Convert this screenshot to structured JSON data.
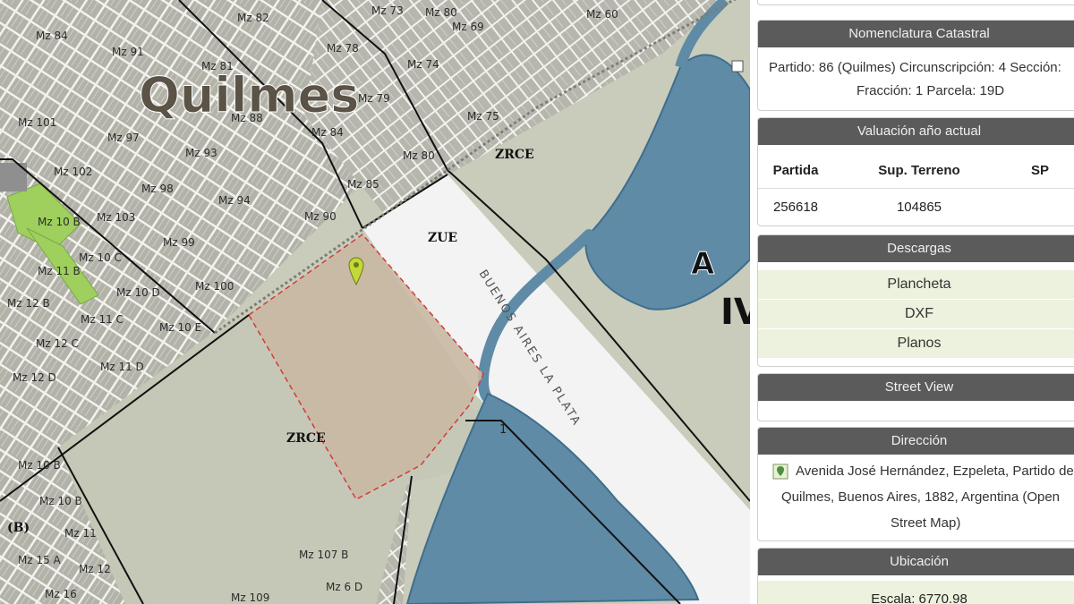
{
  "map": {
    "city_label": "Quilmes",
    "road_name": "BUENOS AIRES LA PLATA",
    "zones": [
      "ZRCE",
      "ZUE",
      "ZRCE"
    ],
    "big_letters": [
      "A",
      "IV"
    ],
    "route_marker": "1",
    "side_label": "(B)",
    "blocks": [
      "Mz 84",
      "Mz 80",
      "Mz 82",
      "Mz 73",
      "Mz 60",
      "Mz 69",
      "Mz 91",
      "Mz 81",
      "Mz 78",
      "Mz 74",
      "Mz 101",
      "Mz 88",
      "Mz 79",
      "Mz 75",
      "Mz 97",
      "Mz 84",
      "Mz 93",
      "Mz 80",
      "Mz 102",
      "Mz 98",
      "Mz 85",
      "Mz 94",
      "Mz 90",
      "Mz 10 B",
      "Mz 103",
      "Mz 99",
      "Mz 10 C",
      "Mz 11 B",
      "Mz 10 D",
      "Mz 12 B",
      "Mz 100",
      "Mz 11 C",
      "Mz 10 E",
      "Mz 12 C",
      "Mz 11 D",
      "Mz 12 D",
      "Mz 10 B",
      "Mz 10 B",
      "Mz 11",
      "Mz 15 A",
      "Mz 12",
      "Mz 16",
      "Mz 109",
      "Mz 107 B",
      "Mz 6 D"
    ],
    "colors": {
      "base": "#c9ccbb",
      "blocks": "#b3b3aa",
      "water": "#5e8aa6",
      "parcel": "#c8b9a6",
      "green": "#9ccc5a"
    }
  },
  "panel": {
    "nomenclatura": {
      "header": "Nomenclatura Catastral",
      "line1": "Partido: 86 (Quilmes) Circunscripción: 4 Sección:",
      "line2": "Fracción: 1 Parcela: 19D"
    },
    "valuacion": {
      "header": "Valuación año actual",
      "columns": [
        "Partida",
        "Sup. Terreno",
        "SP"
      ],
      "row": [
        "256618",
        "104865",
        ""
      ]
    },
    "descargas": {
      "header": "Descargas",
      "items": [
        "Plancheta",
        "DXF",
        "Planos"
      ]
    },
    "street_view": {
      "header": "Street View"
    },
    "direccion": {
      "header": "Dirección",
      "line1": "Avenida José Hernández, Ezpeleta, Partido de",
      "line2": "Quilmes, Buenos Aires, 1882, Argentina (Open",
      "line3": "Street Map)",
      "icon": "map-pin-icon"
    },
    "ubicacion": {
      "header": "Ubicación",
      "scale_label": "Escala: 6770.98"
    }
  }
}
